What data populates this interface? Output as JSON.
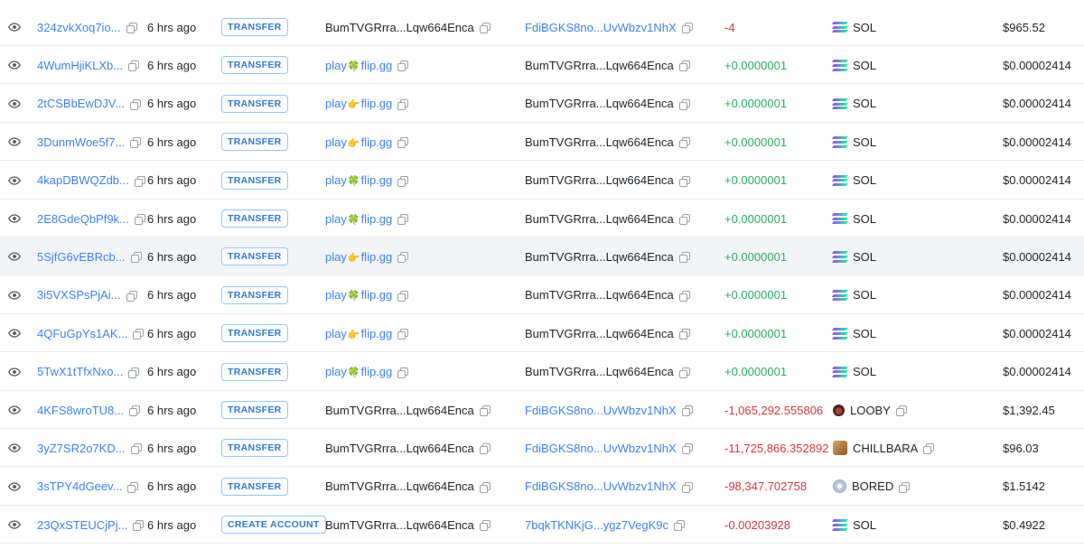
{
  "rows": [
    {
      "signature": "324zvkXoq7io...",
      "time": "6 hrs ago",
      "type": "TRANSFER",
      "from": "BumTVGRrra...Lqw664Enca",
      "from_kind": "address",
      "from_link": false,
      "to": "FdiBGKS8no...UvWbzv1NhX",
      "to_link": true,
      "amount": "-4",
      "amount_sign": "neg",
      "token": "SOL",
      "token_icon": "sol-icon",
      "value": "$965.52"
    },
    {
      "signature": "4WumHjiKLXb...",
      "time": "6 hrs ago",
      "type": "TRANSFER",
      "from_prefix": "play",
      "from_emoji": "🍀",
      "from_suffix": "flip.gg",
      "from_kind": "domain",
      "to": "BumTVGRrra...Lqw664Enca",
      "to_link": false,
      "amount": "+0.0000001",
      "amount_sign": "pos",
      "token": "SOL",
      "token_icon": "sol-icon",
      "value": "$0.00002414"
    },
    {
      "signature": "2tCSBbEwDJV...",
      "time": "6 hrs ago",
      "type": "TRANSFER",
      "from_prefix": "play",
      "from_emoji": "👉",
      "from_suffix": "flip.gg",
      "from_kind": "domain",
      "to": "BumTVGRrra...Lqw664Enca",
      "to_link": false,
      "amount": "+0.0000001",
      "amount_sign": "pos",
      "token": "SOL",
      "token_icon": "sol-icon",
      "value": "$0.00002414"
    },
    {
      "signature": "3DunmWoe5f7...",
      "time": "6 hrs ago",
      "type": "TRANSFER",
      "from_prefix": "play",
      "from_emoji": "👉",
      "from_suffix": "flip.gg",
      "from_kind": "domain",
      "to": "BumTVGRrra...Lqw664Enca",
      "to_link": false,
      "amount": "+0.0000001",
      "amount_sign": "pos",
      "token": "SOL",
      "token_icon": "sol-icon",
      "value": "$0.00002414"
    },
    {
      "signature": "4kapDBWQZdb...",
      "time": "6 hrs ago",
      "type": "TRANSFER",
      "from_prefix": "play",
      "from_emoji": "🍀",
      "from_suffix": "flip.gg",
      "from_kind": "domain",
      "to": "BumTVGRrra...Lqw664Enca",
      "to_link": false,
      "amount": "+0.0000001",
      "amount_sign": "pos",
      "token": "SOL",
      "token_icon": "sol-icon",
      "value": "$0.00002414"
    },
    {
      "signature": "2E8GdeQbPf9k...",
      "time": "6 hrs ago",
      "type": "TRANSFER",
      "from_prefix": "play",
      "from_emoji": "🍀",
      "from_suffix": "flip.gg",
      "from_kind": "domain",
      "to": "BumTVGRrra...Lqw664Enca",
      "to_link": false,
      "amount": "+0.0000001",
      "amount_sign": "pos",
      "token": "SOL",
      "token_icon": "sol-icon",
      "value": "$0.00002414"
    },
    {
      "signature": "5SjfG6vEBRcb...",
      "time": "6 hrs ago",
      "type": "TRANSFER",
      "from_prefix": "play",
      "from_emoji": "👉",
      "from_suffix": "flip.gg",
      "from_kind": "domain",
      "to": "BumTVGRrra...Lqw664Enca",
      "to_link": false,
      "amount": "+0.0000001",
      "amount_sign": "pos",
      "token": "SOL",
      "token_icon": "sol-icon",
      "value": "$0.00002414",
      "hover": true
    },
    {
      "signature": "3i5VXSPsPjAi...",
      "time": "6 hrs ago",
      "type": "TRANSFER",
      "from_prefix": "play",
      "from_emoji": "🍀",
      "from_suffix": "flip.gg",
      "from_kind": "domain",
      "to": "BumTVGRrra...Lqw664Enca",
      "to_link": false,
      "amount": "+0.0000001",
      "amount_sign": "pos",
      "token": "SOL",
      "token_icon": "sol-icon",
      "value": "$0.00002414"
    },
    {
      "signature": "4QFuGpYs1AK...",
      "time": "6 hrs ago",
      "type": "TRANSFER",
      "from_prefix": "play",
      "from_emoji": "👉",
      "from_suffix": "flip.gg",
      "from_kind": "domain",
      "to": "BumTVGRrra...Lqw664Enca",
      "to_link": false,
      "amount": "+0.0000001",
      "amount_sign": "pos",
      "token": "SOL",
      "token_icon": "sol-icon",
      "value": "$0.00002414"
    },
    {
      "signature": "5TwX1tTfxNxo...",
      "time": "6 hrs ago",
      "type": "TRANSFER",
      "from_prefix": "play",
      "from_emoji": "🍀",
      "from_suffix": "flip.gg",
      "from_kind": "domain",
      "to": "BumTVGRrra...Lqw664Enca",
      "to_link": false,
      "amount": "+0.0000001",
      "amount_sign": "pos",
      "token": "SOL",
      "token_icon": "sol-icon",
      "value": "$0.00002414"
    },
    {
      "signature": "4KFS8wroTU8...",
      "time": "6 hrs ago",
      "type": "TRANSFER",
      "from": "BumTVGRrra...Lqw664Enca",
      "from_kind": "address",
      "from_link": false,
      "to": "FdiBGKS8no...UvWbzv1NhX",
      "to_link": true,
      "amount": "-1,065,292.555806",
      "amount_sign": "neg",
      "token": "LOOBY",
      "token_icon": "looby-icon",
      "value": "$1,392.45"
    },
    {
      "signature": "3yZ7SR2o7KD...",
      "time": "6 hrs ago",
      "type": "TRANSFER",
      "from": "BumTVGRrra...Lqw664Enca",
      "from_kind": "address",
      "from_link": false,
      "to": "FdiBGKS8no...UvWbzv1NhX",
      "to_link": true,
      "amount": "-11,725,866.352892",
      "amount_sign": "neg",
      "token": "CHILLBARA",
      "token_icon": "chillbara-icon",
      "value": "$96.03"
    },
    {
      "signature": "3sTPY4dGeev...",
      "time": "6 hrs ago",
      "type": "TRANSFER",
      "from": "BumTVGRrra...Lqw664Enca",
      "from_kind": "address",
      "from_link": false,
      "to": "FdiBGKS8no...UvWbzv1NhX",
      "to_link": true,
      "amount": "-98,347.702758",
      "amount_sign": "neg",
      "token": "BORED",
      "token_icon": "bored-icon",
      "value": "$1.5142"
    },
    {
      "signature": "23QxSTEUCjPj...",
      "time": "6 hrs ago",
      "type": "CREATE ACCOUNT",
      "from": "BumTVGRrra...Lqw664Enca",
      "from_kind": "address",
      "from_link": false,
      "to": "7bqkTKNKjG...ygz7VegK9c",
      "to_link": true,
      "amount": "-0.00203928",
      "amount_sign": "neg",
      "token": "SOL",
      "token_icon": "sol-icon",
      "value": "$0.4922"
    }
  ],
  "colors": {
    "link": "#3b82f6",
    "positive": "#27ae60",
    "negative": "#d9363e",
    "badge": "#2e7ad1"
  }
}
